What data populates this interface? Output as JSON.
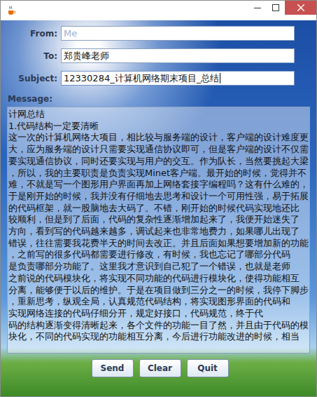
{
  "window": {
    "title": ""
  },
  "fields": [
    {
      "label": "From:",
      "value": "Me",
      "placeholder": true,
      "focused": false
    },
    {
      "label": "To:",
      "value": "郑贵峰老师",
      "placeholder": false,
      "focused": false
    },
    {
      "label": "Subject:",
      "value": "12330284_计算机网络期末项目_总结",
      "placeholder": false,
      "focused": true
    }
  ],
  "message": {
    "label": "Message:",
    "lines": [
      "计网总结",
      "1.代码结构一定要清晰",
      "这一次的计算机网络大项目，相比较与服务端的设计，客户端的设计难度更",
      "大，应为服务端的设计只需要实现通信协议即可，但是客户端的设计不仅需",
      "要实现通信协议，同时还要实现与用户的交互。作为队长，当然要挑起大梁",
      "，所以，我的主要职责是负责实现Minet客户端。最开始的时候，觉得并不",
      "难，不就是写一个图形用户界面再加上网络套接字编程吗？这有什么难的，",
      "于是刚开始的时候，我并没有仔细地去思考和设计一个可用性强，易于拓展",
      "的代码框架，就一股脑地去大码了。不错，刚开始的时候代码实现地还比",
      "较顺利，但是到了后面，代码的复杂性逐渐增加起来了，我便开始迷失了",
      "方向，看到写的代码越来越多，调试起来也非常地费力，如果哪儿出现了",
      "错误，往往需要我花费半天的时间去改正。并且后面如果想要增加新的功能",
      "，之前写的很多代码都需要进行修改，有时候，我也忘记了哪部分代码",
      "是负责哪部分功能了。这里我才意识到自己犯了一个错误，也就是老师",
      "之前说的代码模块化，将实现不同功能的代码进行模块化，使得功能相互",
      "分离，能够便于以后的维护。于是在项目做到三分之一的时候，我停下脚步",
      "，重新思考，纵观全局，认真规范代码结构，将实现图形界面的代码和",
      "实现网络连接的代码仔细分开，规定好接口，代码规范，终于代",
      "码的结构逐渐变得清晰起来，各个文件的功能一目了然，并且由于代码的模",
      "块化，不同的代码实现的功能相互分离，今后进行功能改进的时候，相当"
    ]
  },
  "buttons": [
    "Send",
    "Clear",
    "Quit"
  ]
}
